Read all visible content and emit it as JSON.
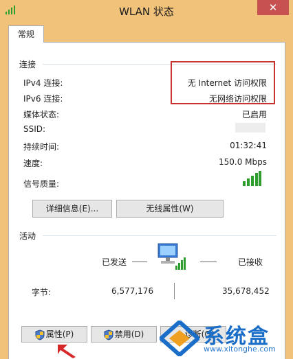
{
  "window": {
    "title": "WLAN 状态",
    "close_glyph": "✕"
  },
  "tabs": [
    {
      "label": "常规"
    }
  ],
  "connection": {
    "section_label": "连接",
    "rows": [
      {
        "label": "IPv4 连接:",
        "value": "无 Internet 访问权限"
      },
      {
        "label": "IPv6 连接:",
        "value": "无网络访问权限"
      },
      {
        "label": "媒体状态:",
        "value": "已启用"
      },
      {
        "label": "SSID:",
        "value": ""
      },
      {
        "label": "持续时间:",
        "value": "01:32:41"
      },
      {
        "label": "速度:",
        "value": "150.0 Mbps"
      },
      {
        "label": "信号质量:",
        "value": ""
      }
    ],
    "signal_icon": "signal-strength-icon",
    "buttons": {
      "details": "详细信息(E)...",
      "wireless_props": "无线属性(W)"
    }
  },
  "activity": {
    "section_label": "活动",
    "sent_label": "已发送",
    "received_label": "已接收",
    "bytes_label": "字节:",
    "sent_bytes": "6,577,176",
    "received_bytes": "35,678,452",
    "network_icon": "network-computer-icon"
  },
  "bottom_buttons": {
    "properties": "属性(P)",
    "disable": "禁用(D)",
    "diagnose": "诊断(G)"
  },
  "watermark": {
    "brand": "系统盒",
    "url": "www.xitonghe.com"
  },
  "colors": {
    "highlight": "#c8322f",
    "signal": "#2e9e2e",
    "accent": "#1a6ec8"
  }
}
